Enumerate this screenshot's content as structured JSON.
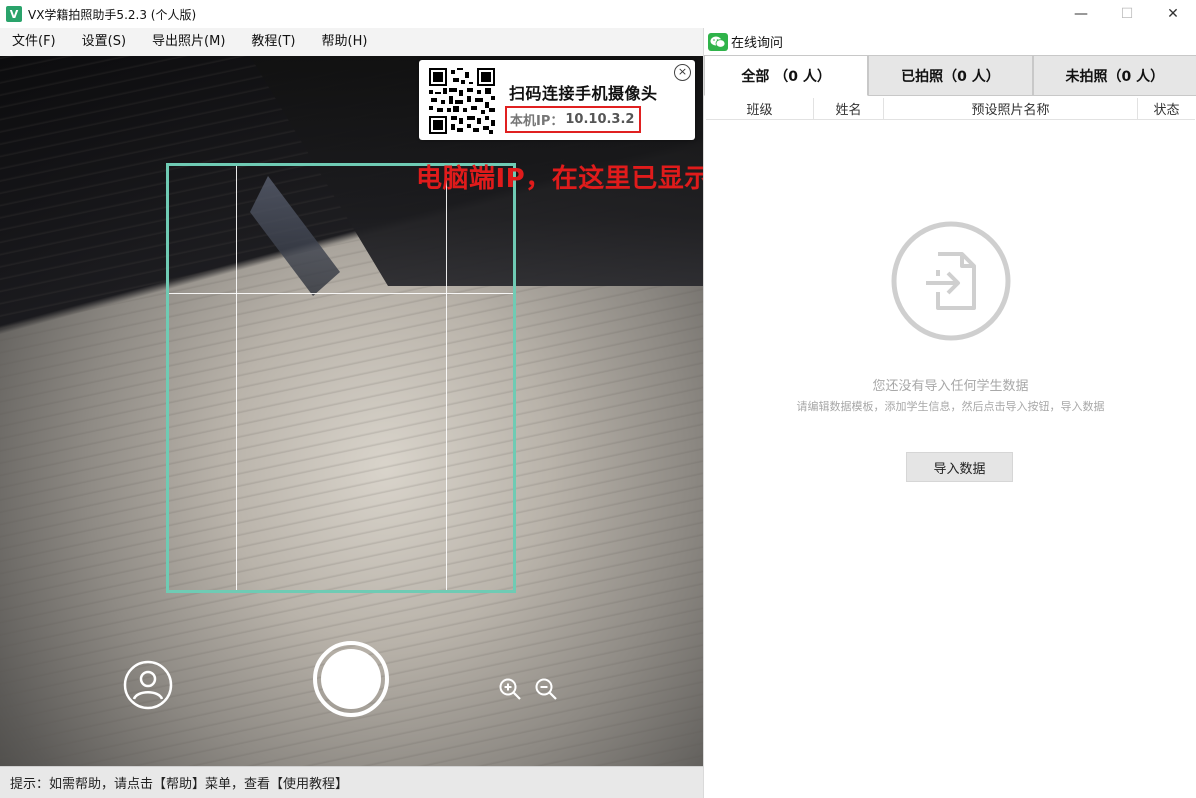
{
  "window": {
    "title": "VX学籍拍照助手5.2.3 (个人版)",
    "logo_letter": "V",
    "controls": {
      "minimize": "—",
      "maximize": "☐",
      "close": "✕"
    }
  },
  "menu": {
    "items": [
      "文件(F)",
      "设置(S)",
      "导出照片(M)",
      "教程(T)",
      "帮助(H)"
    ]
  },
  "qr_panel": {
    "title": "扫码连接手机摄像头",
    "ip_label": "本机IP：",
    "ip_value": "10.10.3.2",
    "close": "×"
  },
  "annotation": "电脑端IP，在这里已显示，在手机端填入此ip",
  "status_bar": {
    "text": "提示：如需帮助，请点击【帮助】菜单，查看【使用教程】"
  },
  "right_panel": {
    "online_label": "在线询问",
    "tabs": [
      "全部 （0 人）",
      "已拍照（0 人）",
      "未拍照（0 人）"
    ],
    "columns": [
      "班级",
      "姓名",
      "预设照片名称",
      "状态"
    ],
    "empty_title": "您还没有导入任何学生数据",
    "empty_subtitle": "请编辑数据模板，添加学生信息，然后点击导入按钮，导入数据",
    "import_button": "导入数据"
  },
  "colors": {
    "crop_frame": "#6fcbb4",
    "annotation": "#e01b1b",
    "ip_box_border": "#e02020",
    "wechat": "#2fb34a"
  },
  "icons": {
    "profile": "user-circle-icon",
    "shutter": "shutter-button",
    "zoom_in": "zoom-in-icon",
    "zoom_out": "zoom-out-icon",
    "empty": "import-file-icon",
    "wechat": "wechat-icon"
  }
}
